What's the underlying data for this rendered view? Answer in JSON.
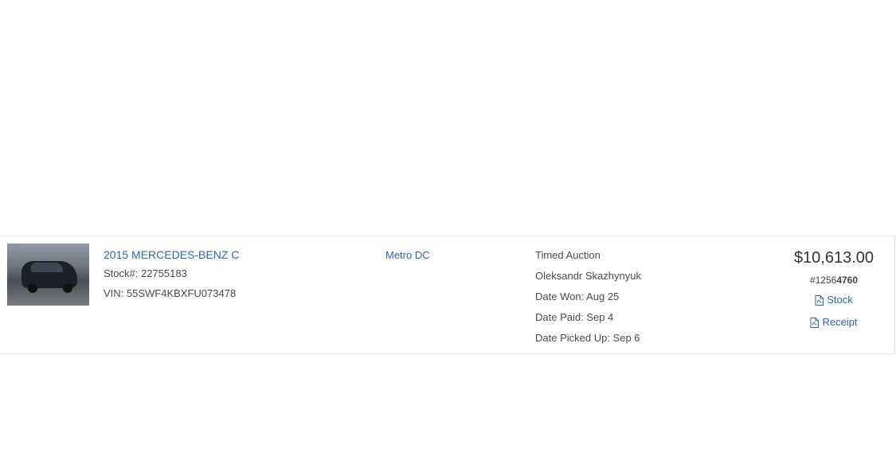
{
  "vehicle": {
    "title": "2015 MERCEDES-BENZ C",
    "stock": "Stock#: 22755183",
    "vin": "VIN: 55SWF4KBXFU073478"
  },
  "location": "Metro DC",
  "details": {
    "auction_type": "Timed Auction",
    "buyer": "Oleksandr Skazhynyuk",
    "date_won": "Date Won: Aug 25",
    "date_paid": "Date Paid: Sep 4",
    "date_picked_up": "Date Picked Up: Sep 6"
  },
  "price": {
    "amount": "$10,613.00",
    "invoice_prefix": "#1256",
    "invoice_bold": "4760",
    "stock_link": "Stock",
    "receipt_link": "Receipt"
  },
  "icons": {
    "pdf": "pdf-document-icon"
  },
  "colors": {
    "link": "#2a66b3",
    "text": "#4a4a4a",
    "border": "#e2e2e2"
  }
}
